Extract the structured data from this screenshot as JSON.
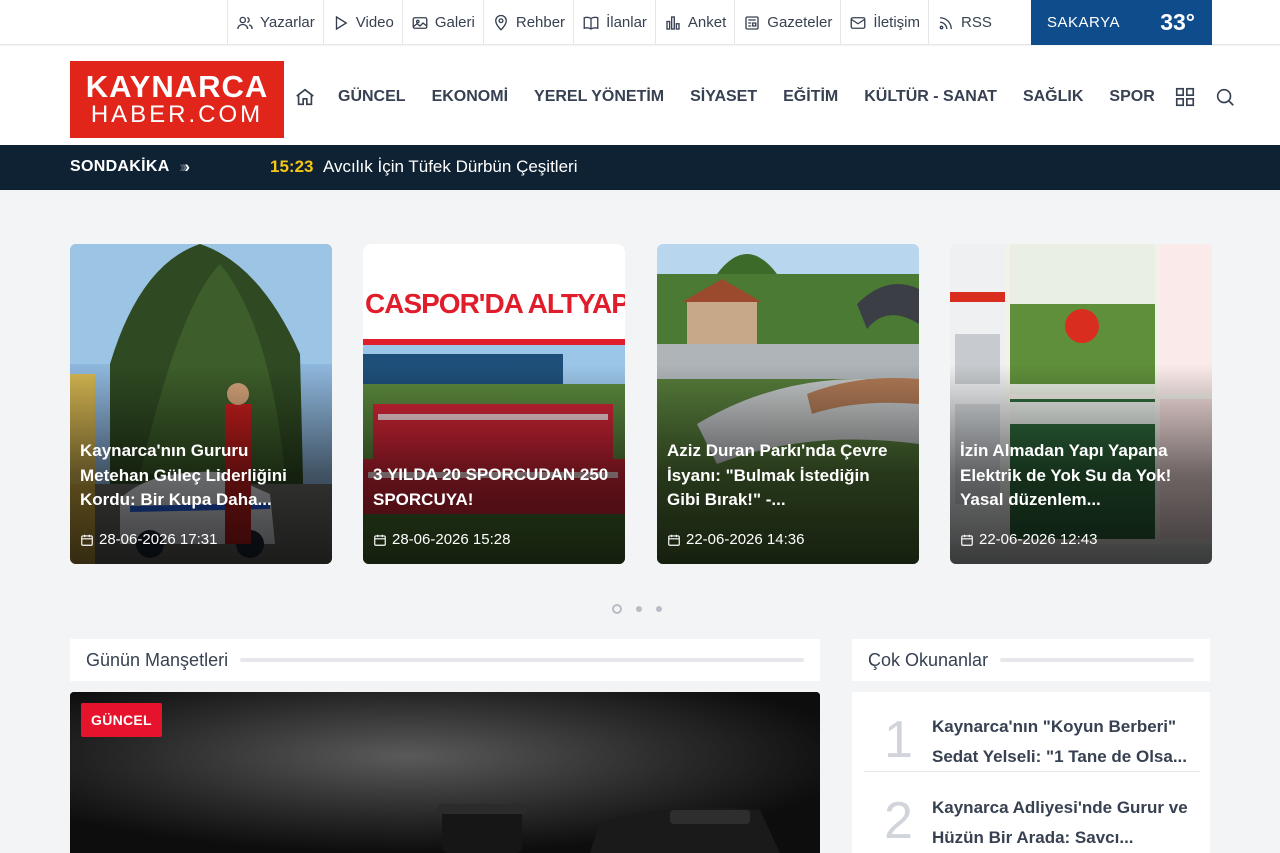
{
  "topbar": {
    "links": [
      {
        "label": "Yazarlar",
        "icon": "users-icon"
      },
      {
        "label": "Video",
        "icon": "play-icon"
      },
      {
        "label": "Galeri",
        "icon": "image-icon"
      },
      {
        "label": "Rehber",
        "icon": "location-icon"
      },
      {
        "label": "İlanlar",
        "icon": "book-icon"
      },
      {
        "label": "Anket",
        "icon": "bar-chart-icon"
      },
      {
        "label": "Gazeteler",
        "icon": "newspaper-icon"
      },
      {
        "label": "İletişim",
        "icon": "mail-icon"
      },
      {
        "label": "RSS",
        "icon": "rss-icon"
      }
    ],
    "weather": {
      "city": "SAKARYA",
      "temp": "33°"
    }
  },
  "logo": {
    "line1": "KAYNARCA",
    "line2": "HABER.COM"
  },
  "nav": {
    "items": [
      "GÜNCEL",
      "EKONOMİ",
      "YEREL YÖNETİM",
      "SİYASET",
      "EĞİTİM",
      "KÜLTÜR - SANAT",
      "SAĞLIK",
      "SPOR"
    ]
  },
  "breaking": {
    "label": "SONDAKİKA",
    "time": "15:23",
    "headline": "Avcılık İçin Tüfek Dürbün Çeşitleri"
  },
  "slider": {
    "cards": [
      {
        "title": "Kaynarca'nın Gururu Metehan Güleç Liderliğini Kordu: Bir Kupa Daha...",
        "date": "28-06-2026 17:31"
      },
      {
        "title": "3 YILDA 20 SPORCUDAN 250 SPORCUYA!",
        "date": "28-06-2026 15:28",
        "image_text": "CASPOR'DA ALTYAPI DE"
      },
      {
        "title": "Aziz Duran Parkı'nda Çevre İsyanı: \"Bulmak İstediğin Gibi Bırak!\" -...",
        "date": "22-06-2026 14:36"
      },
      {
        "title": "İzin Almadan Yapı Yapana Elektrik de Yok Su da Yok! Yasal düzenlem...",
        "date": "22-06-2026 12:43"
      }
    ],
    "dots": 3,
    "active_dot": 0
  },
  "sections": {
    "headlines_title": "Günün Manşetleri",
    "popular_title": "Çok Okunanlar"
  },
  "main": {
    "badge": "GÜNCEL"
  },
  "popular": {
    "items": [
      {
        "num": "1",
        "text": "Kaynarca'nın \"Koyun Berberi\" Sedat Yelseli: \"1 Tane de Olsa..."
      },
      {
        "num": "2",
        "text": "Kaynarca Adliyesi'nde Gurur ve Hüzün Bir Arada: Savcı..."
      }
    ]
  },
  "colors": {
    "brand_red": "#e1251b",
    "weather_blue": "#0f4c8c",
    "breaking_bg": "#0f2233",
    "badge_red": "#e5132b",
    "time_yellow": "#f5c518"
  }
}
